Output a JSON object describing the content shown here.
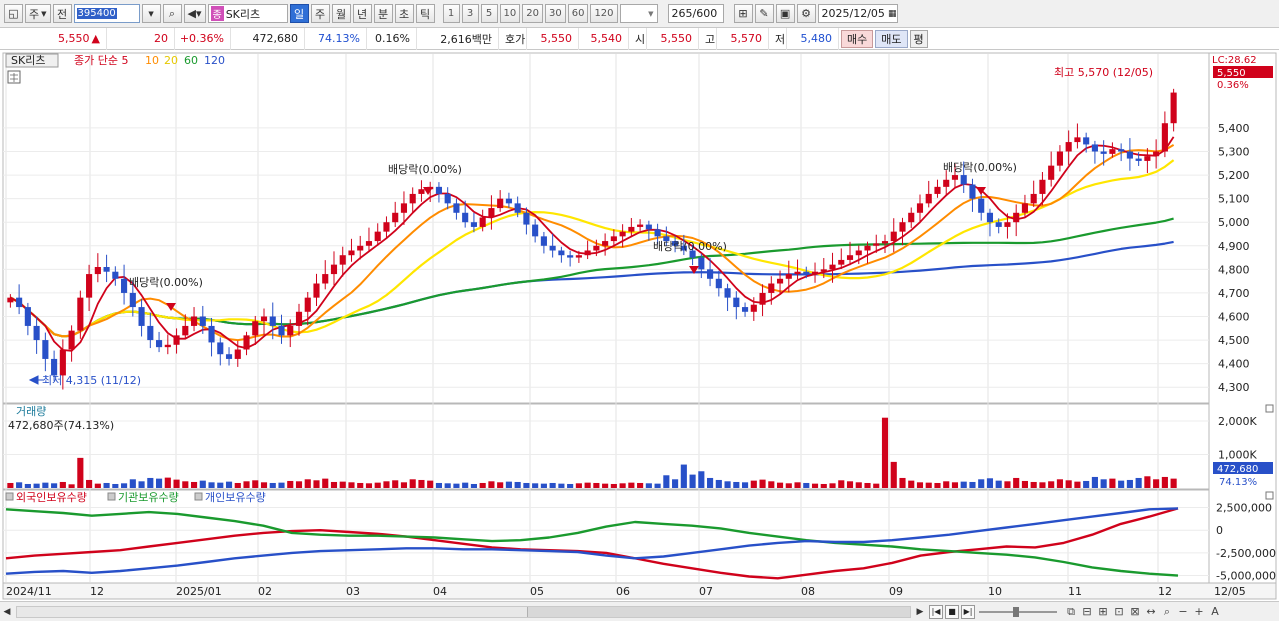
{
  "toolbar": {
    "type_select": "주",
    "prefix_btn": "전",
    "code": "395400",
    "name_tag": "종",
    "name": "SK리츠",
    "periods": [
      "일",
      "주",
      "월",
      "년",
      "분",
      "초",
      "틱"
    ],
    "active_period": "일",
    "intervals": [
      "1",
      "3",
      "5",
      "10",
      "20",
      "30",
      "60",
      "120"
    ],
    "count": "265",
    "count_total": "/600",
    "date": "2025/12/05"
  },
  "quote": {
    "price": "5,550",
    "change_arrow": "▲",
    "change": "20",
    "change_pct": "+0.36%",
    "volume": "472,680",
    "volume_ratio": "74.13%",
    "turnover_pct": "0.16%",
    "amount": "2,616백만",
    "ask_label": "호가",
    "ask1": "5,550",
    "bid1": "5,540",
    "open_label": "시",
    "open": "5,550",
    "high_label": "고",
    "high": "5,570",
    "low_label": "저",
    "low": "5,480",
    "buy_label": "매수",
    "sell_label": "매도",
    "even_label": "평"
  },
  "chart_data": [
    {
      "type": "candlestick",
      "title": "SK리츠",
      "legend": [
        "종가 단순 5",
        "10",
        "20",
        "60",
        "120"
      ],
      "legend_colors": [
        "#d0021b",
        "#ff8c00",
        "#ffe600",
        "#1a9a2e",
        "#2850c8"
      ],
      "ylim": [
        4250,
        5650
      ],
      "yticks": [
        4300,
        4400,
        4500,
        4600,
        4700,
        4800,
        4900,
        5000,
        5100,
        5200,
        5300,
        5400
      ],
      "ytick_labels": [
        "4,300",
        "4,400",
        "4,500",
        "4,600",
        "4,700",
        "4,800",
        "4,900",
        "5,000",
        "5,100",
        "5,200",
        "5,300",
        "5,400"
      ],
      "x_labels": [
        "2024/11",
        "12",
        "2025/01",
        "02",
        "03",
        "04",
        "05",
        "06",
        "07",
        "08",
        "09",
        "10",
        "11",
        "12"
      ],
      "last_date_label": "12/05",
      "lc_label": "LC:28.62",
      "last_price_label": "5,550",
      "last_pct_label": "0.36%",
      "high_annotation": "최고 5,570 (12/05)",
      "low_annotation": "최저 4,315 (11/12)",
      "dividend_annotations": [
        "배당락(0.00%)",
        "배당락(0.00%)",
        "배당락(0.00%)",
        "배당락(0.00%)"
      ],
      "close_series": [
        4680,
        4640,
        4560,
        4500,
        4420,
        4350,
        4460,
        4540,
        4680,
        4780,
        4810,
        4790,
        4760,
        4700,
        4640,
        4560,
        4500,
        4470,
        4480,
        4520,
        4560,
        4600,
        4560,
        4490,
        4440,
        4420,
        4460,
        4520,
        4580,
        4600,
        4560,
        4520,
        4560,
        4620,
        4680,
        4740,
        4780,
        4820,
        4860,
        4880,
        4900,
        4920,
        4960,
        5000,
        5040,
        5080,
        5120,
        5140,
        5150,
        5120,
        5080,
        5040,
        5000,
        4980,
        5020,
        5060,
        5100,
        5080,
        5040,
        4990,
        4940,
        4900,
        4880,
        4860,
        4850,
        4860,
        4880,
        4900,
        4920,
        4940,
        4960,
        4980,
        4990,
        4970,
        4940,
        4920,
        4900,
        4880,
        4850,
        4800,
        4760,
        4720,
        4680,
        4640,
        4620,
        4650,
        4700,
        4740,
        4760,
        4780,
        4790,
        4780,
        4790,
        4800,
        4820,
        4840,
        4860,
        4880,
        4900,
        4910,
        4920,
        4960,
        5000,
        5040,
        5080,
        5120,
        5150,
        5180,
        5200,
        5160,
        5100,
        5040,
        5000,
        4980,
        5000,
        5040,
        5080,
        5120,
        5180,
        5240,
        5300,
        5340,
        5360,
        5330,
        5300,
        5290,
        5310,
        5300,
        5270,
        5260,
        5280,
        5300,
        5420,
        5550
      ]
    },
    {
      "type": "bar",
      "title": "거래량",
      "subtitle": "472,680주(74.13%)",
      "yticks": [
        1000000,
        2000000
      ],
      "ytick_labels": [
        "1,000K",
        "2,000K"
      ],
      "last_value_label": "472,680",
      "last_pct_label": "74.13%",
      "values": [
        150,
        170,
        120,
        130,
        160,
        140,
        180,
        110,
        900,
        240,
        130,
        150,
        120,
        140,
        260,
        200,
        300,
        280,
        310,
        250,
        200,
        180,
        220,
        170,
        160,
        190,
        150,
        200,
        230,
        170,
        150,
        160,
        210,
        200,
        260,
        230,
        280,
        180,
        190,
        170,
        150,
        140,
        160,
        200,
        230,
        170,
        260,
        240,
        220,
        150,
        140,
        130,
        160,
        120,
        150,
        200,
        170,
        190,
        180,
        150,
        140,
        130,
        150,
        130,
        120,
        140,
        160,
        150,
        130,
        120,
        140,
        160,
        150,
        140,
        130,
        380,
        260,
        700,
        400,
        500,
        300,
        240,
        200,
        180,
        170,
        220,
        250,
        200,
        160,
        140,
        170,
        150,
        130,
        120,
        140,
        230,
        200,
        170,
        150,
        130,
        2100,
        780,
        300,
        220,
        170,
        160,
        150,
        200,
        170,
        190,
        180,
        260,
        290,
        220,
        200,
        300,
        210,
        180,
        170,
        200,
        260,
        230,
        190,
        210,
        330,
        260,
        280,
        220,
        240,
        300,
        350,
        260,
        330,
        280
      ]
    },
    {
      "type": "line",
      "legend": [
        "외국인보유수량",
        "기관보유수량",
        "개인보유수량"
      ],
      "legend_colors": [
        "#d0021b",
        "#1a9a2e",
        "#2850c8"
      ],
      "yticks": [
        2500000,
        0,
        -2500000,
        -5000000
      ],
      "ytick_labels": [
        "2,500,000",
        "0",
        "-2,500,000",
        "-5,000,000"
      ],
      "series": [
        {
          "name": "외국인보유수량",
          "values": [
            -3100000,
            -2800000,
            -2600000,
            -2400000,
            -2200000,
            -1800000,
            -1400000,
            -1000000,
            -600000,
            -300000,
            -100000,
            0,
            -200000,
            -400000,
            -700000,
            -1100000,
            -1500000,
            -1900000,
            -2100000,
            -2200000,
            -2300000,
            -2500000,
            -3100000,
            -3700000,
            -4200000,
            -4700000,
            -5100000,
            -5300000,
            -4900000,
            -4500000,
            -4200000,
            -3600000,
            -2800000,
            -2400000,
            -2100000,
            -1800000,
            -1900000,
            -1400000,
            -500000,
            700000,
            1500000,
            2400000
          ]
        },
        {
          "name": "기관보유수량",
          "values": [
            2300000,
            2100000,
            1900000,
            1600000,
            1800000,
            2000000,
            1800000,
            1400000,
            1000000,
            500000,
            -300000,
            -500000,
            -600000,
            -600000,
            -700000,
            -800000,
            -1000000,
            -1200000,
            -1100000,
            -800000,
            -300000,
            400000,
            900000,
            700000,
            500000,
            200000,
            -300000,
            -700000,
            -1100000,
            -1400000,
            -1600000,
            -1800000,
            -2100000,
            -2300000,
            -2500000,
            -2700000,
            -3000000,
            -3500000,
            -4100000,
            -4500000,
            -4800000,
            -5000000
          ]
        },
        {
          "name": "개인보유수량",
          "values": [
            -4800000,
            -4600000,
            -4500000,
            -4700000,
            -4500000,
            -4200000,
            -3900000,
            -3500000,
            -3100000,
            -2800000,
            -2500000,
            -2300000,
            -2200000,
            -2100000,
            -2000000,
            -2000000,
            -2100000,
            -2100000,
            -2200000,
            -2300000,
            -2400000,
            -2800000,
            -3100000,
            -2900000,
            -2500000,
            -2100000,
            -1700000,
            -1400000,
            -1200000,
            -1300000,
            -1300000,
            -1100000,
            -800000,
            -500000,
            -100000,
            300000,
            700000,
            1100000,
            1500000,
            1900000,
            2300000,
            2400000
          ]
        }
      ]
    }
  ]
}
